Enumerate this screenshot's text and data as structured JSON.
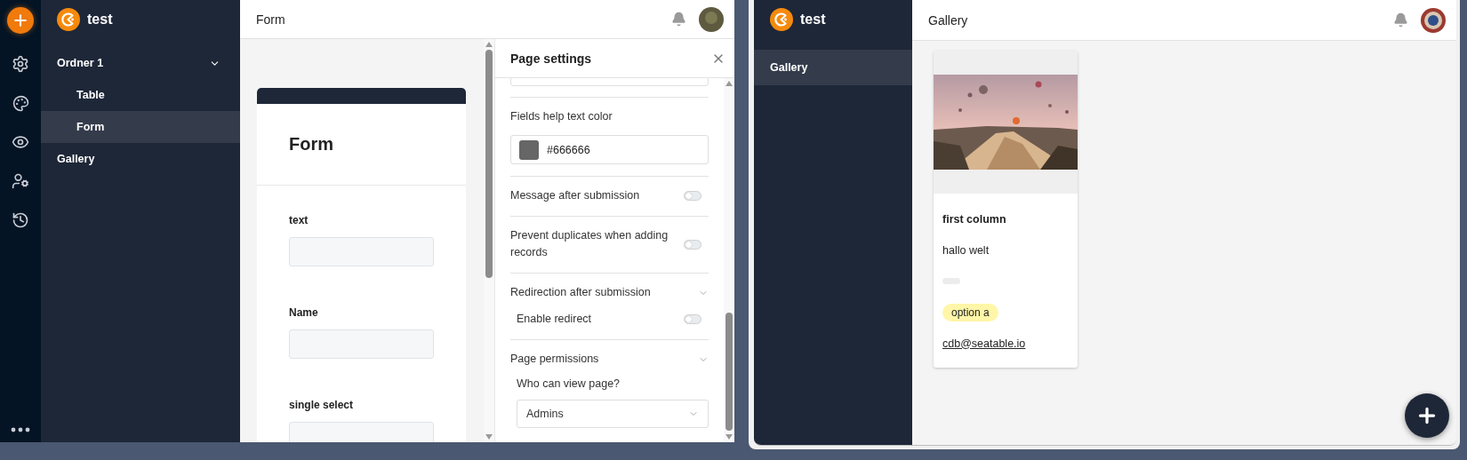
{
  "left_window": {
    "app_name": "test",
    "nav": [
      {
        "label": "Ordner 1",
        "expanded": true,
        "selected": false,
        "children": [
          {
            "label": "Table",
            "selected": false
          },
          {
            "label": "Form",
            "selected": true
          }
        ]
      },
      {
        "label": "Gallery",
        "selected": false
      }
    ],
    "page_title": "Form",
    "form_preview": {
      "title": "Form",
      "fields": [
        {
          "label": "text"
        },
        {
          "label": "Name"
        },
        {
          "label": "single select"
        }
      ]
    },
    "settings": {
      "title": "Page settings",
      "rows": [
        {
          "kind": "color",
          "label": "Fields help text color",
          "value": "#666666"
        },
        {
          "kind": "toggle",
          "label": "Message after submission",
          "on": false
        },
        {
          "kind": "toggle",
          "label": "Prevent duplicates when adding records",
          "on": false
        },
        {
          "kind": "section",
          "label": "Redirection after submission",
          "expanded": true,
          "children": [
            {
              "kind": "toggle",
              "label": "Enable redirect",
              "on": false
            }
          ]
        },
        {
          "kind": "section",
          "label": "Page permissions",
          "expanded": true,
          "children": [
            {
              "kind": "select",
              "label": "Who can view page?",
              "value": "Admins"
            }
          ]
        }
      ]
    }
  },
  "right_window": {
    "app_name": "test",
    "nav": [
      {
        "label": "Gallery",
        "selected": true
      }
    ],
    "page_title": "Gallery",
    "card": {
      "title": "first column",
      "fields": [
        {
          "kind": "text",
          "value": "hallo welt"
        },
        {
          "kind": "blank"
        },
        {
          "kind": "tag",
          "value": "option a"
        },
        {
          "kind": "email",
          "value": "cdb@seatable.io"
        }
      ]
    }
  }
}
